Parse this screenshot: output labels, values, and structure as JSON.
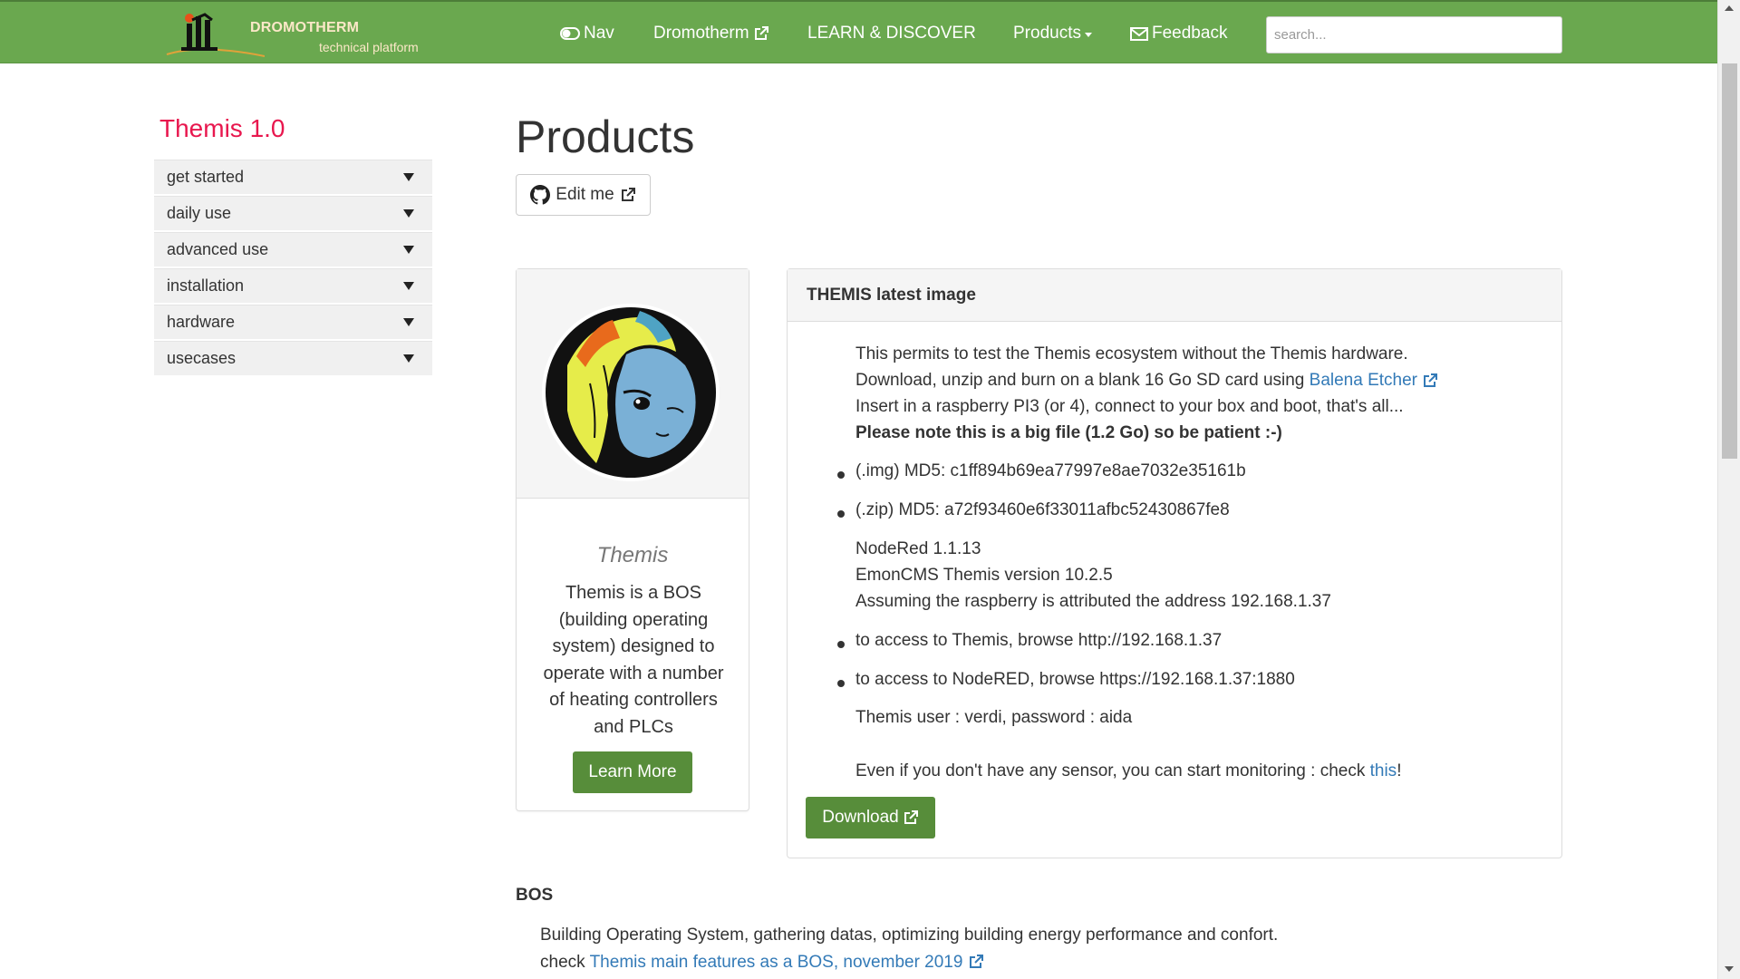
{
  "navbar": {
    "brand_title": "DROMOTHERM",
    "brand_subtitle": "technical platform",
    "items": [
      {
        "label": "Nav",
        "icon": "toggle-icon"
      },
      {
        "label": "Dromotherm",
        "icon": "external-link-icon"
      },
      {
        "label": "LEARN & DISCOVER"
      },
      {
        "label": "Products",
        "icon": "caret-down-icon"
      },
      {
        "label": "Feedback",
        "icon": "envelope-icon"
      }
    ],
    "search_placeholder": "search..."
  },
  "sidebar": {
    "title": "Themis 1.0",
    "items": [
      {
        "label": "get started"
      },
      {
        "label": "daily use"
      },
      {
        "label": "advanced use"
      },
      {
        "label": "installation"
      },
      {
        "label": "hardware"
      },
      {
        "label": "usecases"
      }
    ]
  },
  "main": {
    "title": "Products",
    "edit_label": "Edit me"
  },
  "card": {
    "name": "Themis",
    "description": "Themis is a BOS (building operating system) designed to operate with a number of heating controllers and PLCs",
    "button": "Learn More"
  },
  "panel": {
    "heading": "THEMIS latest image",
    "line1": "This permits to test the Themis ecosystem without the Themis hardware.",
    "line2_prefix": "Download, unzip and burn on a blank 16 Go SD card using ",
    "line2_link": "Balena Etcher",
    "line3": "Insert in a raspberry PI3 (or 4), connect to your box and boot, that's all...",
    "line4": "Please note this is a big file (1.2 Go) so be patient :-)",
    "md5_img": "(.img) MD5: c1ff894b69ea77997e8ae7032e35161b",
    "md5_zip": "(.zip) MD5: a72f93460e6f33011afbc52430867fe8",
    "nodered": "NodeRed 1.1.13",
    "emoncms": "EmonCMS Themis version 10.2.5",
    "address": "Assuming the raspberry is attributed the address 192.168.1.37",
    "access_themis": "to access to Themis, browse http://192.168.1.37",
    "access_nodered": "to access to NodeRED, browse https://192.168.1.37:1880",
    "credentials": "Themis user : verdi, password : aida",
    "monitor_prefix": "Even if you don't have any sensor, you can start monitoring : check ",
    "monitor_link": "this",
    "monitor_suffix": "!",
    "download": "Download"
  },
  "bos": {
    "title": "BOS",
    "line1": "Building Operating System, gathering datas, optimizing building energy performance and confort.",
    "line2_prefix": "check ",
    "line2_link": "Themis main features as a BOS, november 2019"
  },
  "colors": {
    "navbar": "#6aa84f",
    "button_green": "#578d3a",
    "sidebar_title": "#e8174e",
    "link": "#337ab7"
  }
}
